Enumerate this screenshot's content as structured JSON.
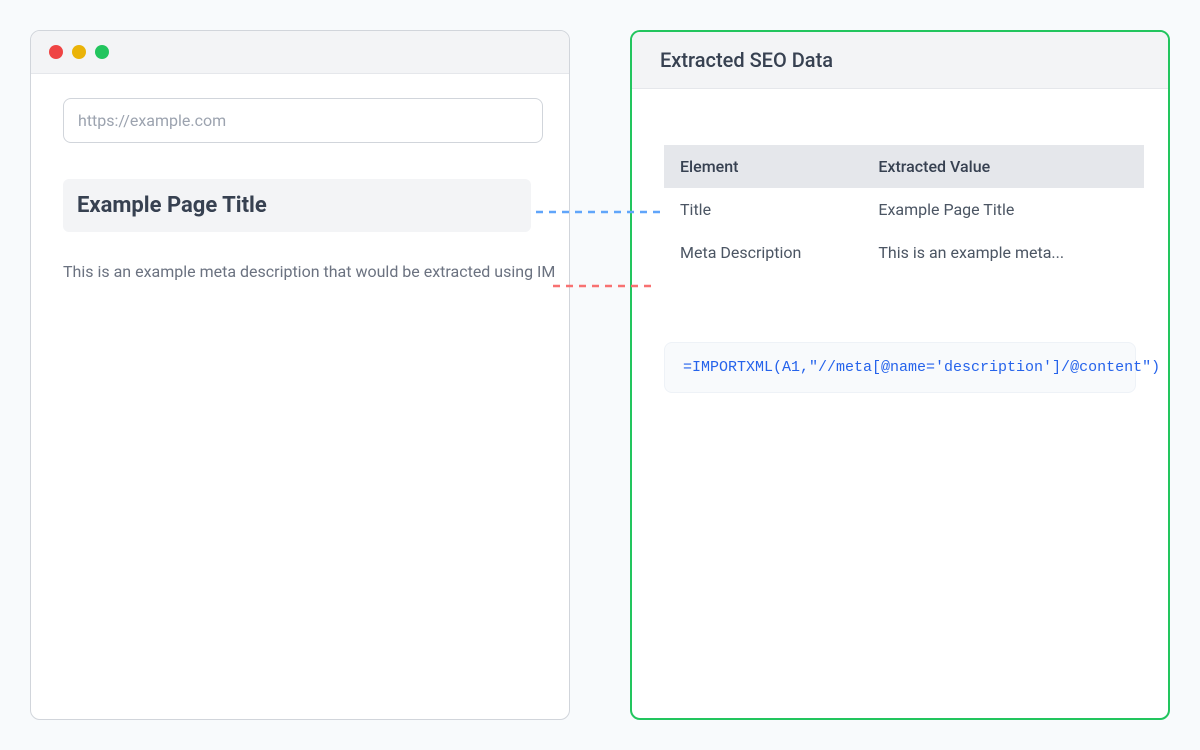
{
  "browser": {
    "url": "https://example.com",
    "page_title": "Example Page Title",
    "meta_description": "This is an example meta description that would be extracted using IM"
  },
  "extracted": {
    "header_title": "Extracted SEO Data",
    "table": {
      "headers": {
        "col1": "Element",
        "col2": "Extracted Value"
      },
      "rows": [
        {
          "element": "Title",
          "value": "Example Page Title"
        },
        {
          "element": "Meta Description",
          "value": "This is an example meta..."
        }
      ]
    },
    "formula": "=IMPORTXML(A1,\"//meta[@name='description']/@content\")"
  },
  "colors": {
    "accent_green": "#22c55e",
    "connector_blue": "#60a5fa",
    "connector_red": "#f87171",
    "formula_blue": "#2563eb"
  }
}
